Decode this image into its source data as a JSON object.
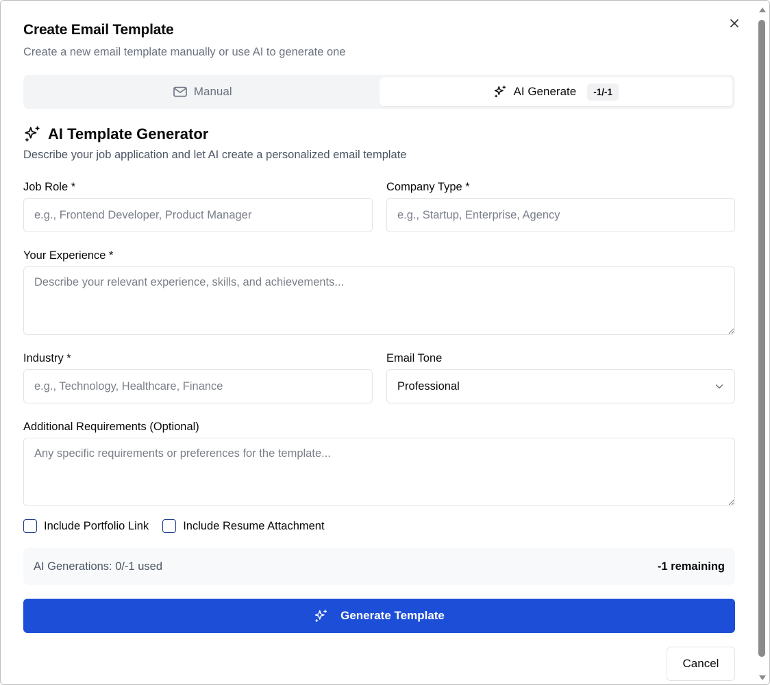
{
  "dialog": {
    "title": "Create Email Template",
    "subtitle": "Create a new email template manually or use AI to generate one",
    "close_icon": "close-icon"
  },
  "tabs": [
    {
      "label": "Manual",
      "icon": "mail-icon",
      "active": false
    },
    {
      "label": "AI Generate",
      "icon": "sparkles-icon",
      "active": true,
      "badge": "-1/-1"
    }
  ],
  "section": {
    "title": "AI Template Generator",
    "icon": "sparkles-icon",
    "description": "Describe your job application and let AI create a personalized email template"
  },
  "form": {
    "job_role": {
      "label": "Job Role *",
      "placeholder": "e.g., Frontend Developer, Product Manager",
      "value": ""
    },
    "company_type": {
      "label": "Company Type *",
      "placeholder": "e.g., Startup, Enterprise, Agency",
      "value": ""
    },
    "experience": {
      "label": "Your Experience *",
      "placeholder": "Describe your relevant experience, skills, and achievements...",
      "value": ""
    },
    "industry": {
      "label": "Industry *",
      "placeholder": "e.g., Technology, Healthcare, Finance",
      "value": ""
    },
    "email_tone": {
      "label": "Email Tone",
      "value": "Professional"
    },
    "additional": {
      "label": "Additional Requirements (Optional)",
      "placeholder": "Any specific requirements or preferences for the template...",
      "value": ""
    },
    "include_portfolio": {
      "label": "Include Portfolio Link",
      "checked": false
    },
    "include_resume": {
      "label": "Include Resume Attachment",
      "checked": false
    }
  },
  "usage": {
    "used_text": "AI Generations: 0/-1 used",
    "remaining_text": "-1 remaining"
  },
  "actions": {
    "generate_label": "Generate Template",
    "cancel_label": "Cancel"
  },
  "colors": {
    "primary": "#1d4ed8",
    "muted_text": "#6b7280",
    "border": "#e2e4e8",
    "tab_bg": "#f3f4f6"
  }
}
